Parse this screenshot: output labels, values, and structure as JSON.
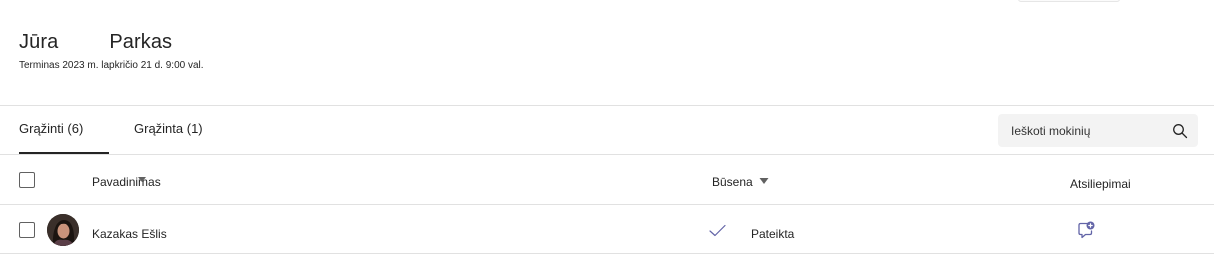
{
  "assignment": {
    "title_part1": "Jūra",
    "title_part2": "Parkas",
    "due": "Terminas 2023 m. lapkričio 21 d. 9:00 val."
  },
  "tabs": [
    {
      "label": "Grąžinti (6)",
      "active": true
    },
    {
      "label": "Grąžinta (1)",
      "active": false
    }
  ],
  "search": {
    "placeholder": "Ieškoti mokinių"
  },
  "table": {
    "columns": {
      "name": "Pavadinimas",
      "status": "Būsena",
      "feedback": "Atsiliepimai"
    },
    "rows": [
      {
        "name": "Kazakas Ešlis",
        "status": "Pateikta"
      }
    ]
  },
  "colors": {
    "accent": "#6264a7",
    "text": "#242424",
    "divider": "#e1e1e1"
  },
  "icons": {
    "search": "search-icon",
    "sort": "sort-down-icon",
    "check": "checkmark-icon",
    "feedback": "add-feedback-icon"
  }
}
